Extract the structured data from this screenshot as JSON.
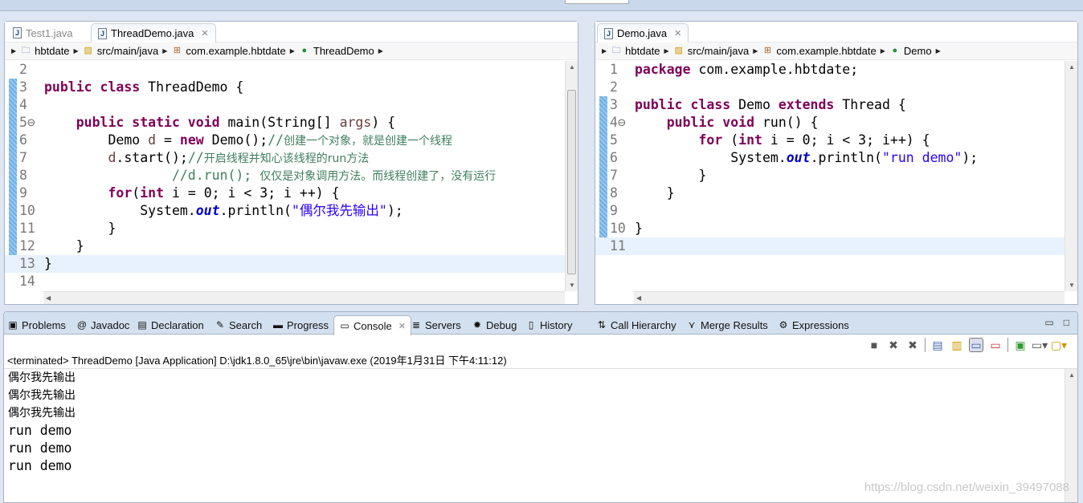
{
  "left_editor": {
    "tabs": [
      {
        "label": "Test1.java",
        "active": false
      },
      {
        "label": "ThreadDemo.java",
        "active": true
      }
    ],
    "breadcrumb": [
      "hbtdate",
      "src/main/java",
      "com.example.hbtdate",
      "ThreadDemo"
    ],
    "lines": [
      {
        "n": "2",
        "t": []
      },
      {
        "n": "3",
        "t": [
          [
            "public class ",
            "kw"
          ],
          [
            "ThreadDemo {",
            ""
          ]
        ]
      },
      {
        "n": "4",
        "t": []
      },
      {
        "n": "5⊖",
        "t": [
          [
            "    public static void ",
            "kw"
          ],
          [
            "main(String[] ",
            ""
          ],
          [
            "args",
            "var"
          ],
          [
            ") {",
            ""
          ]
        ]
      },
      {
        "n": "6",
        "t": [
          [
            "        Demo ",
            ""
          ],
          [
            "d",
            "var"
          ],
          [
            " = ",
            ""
          ],
          [
            "new ",
            "kw"
          ],
          [
            "Demo();",
            ""
          ],
          [
            "//",
            "cmm"
          ],
          [
            "创建一个对象，就是创建一个线程",
            "cm"
          ]
        ]
      },
      {
        "n": "7",
        "t": [
          [
            "        ",
            ""
          ],
          [
            "d",
            "var"
          ],
          [
            ".start();",
            ""
          ],
          [
            "//",
            "cmm"
          ],
          [
            "开启线程并知心该线程的run方法",
            "cm"
          ]
        ]
      },
      {
        "n": "8",
        "t": [
          [
            "                //d.run(); ",
            "cmm"
          ],
          [
            "仅仅是对象调用方法。而线程创建了，没有运行",
            "cm"
          ]
        ]
      },
      {
        "n": "9",
        "t": [
          [
            "        ",
            ""
          ],
          [
            "for",
            "kw"
          ],
          [
            "(",
            ""
          ],
          [
            "int ",
            "kw"
          ],
          [
            "i = 0; i < 3; i ++) {",
            ""
          ]
        ]
      },
      {
        "n": "10",
        "t": [
          [
            "            System.",
            ""
          ],
          [
            "out",
            "fld"
          ],
          [
            ".println(",
            ""
          ],
          [
            "\"偶尔我先输出\"",
            "st"
          ],
          [
            ");",
            ""
          ]
        ]
      },
      {
        "n": "11",
        "t": [
          [
            "        }",
            ""
          ]
        ]
      },
      {
        "n": "12",
        "t": [
          [
            "    }",
            ""
          ]
        ]
      },
      {
        "n": "13",
        "t": [
          [
            "}",
            ""
          ]
        ]
      },
      {
        "n": "14",
        "t": []
      }
    ]
  },
  "right_editor": {
    "tabs": [
      {
        "label": "Demo.java",
        "active": true
      }
    ],
    "breadcrumb": [
      "hbtdate",
      "src/main/java",
      "com.example.hbtdate",
      "Demo"
    ],
    "lines": [
      {
        "n": "1",
        "t": [
          [
            "package ",
            "kw"
          ],
          [
            "com.example.hbtdate;",
            ""
          ]
        ]
      },
      {
        "n": "2",
        "t": []
      },
      {
        "n": "3",
        "t": [
          [
            "public class ",
            "kw"
          ],
          [
            "Demo ",
            ""
          ],
          [
            "extends ",
            "kw"
          ],
          [
            "Thread {",
            ""
          ]
        ]
      },
      {
        "n": "4⊖",
        "t": [
          [
            "    public void ",
            "kw"
          ],
          [
            "run() {",
            ""
          ]
        ]
      },
      {
        "n": "5",
        "t": [
          [
            "        for ",
            "kw"
          ],
          [
            "(",
            ""
          ],
          [
            "int ",
            "kw"
          ],
          [
            "i = 0; i < 3; i++) {",
            ""
          ]
        ]
      },
      {
        "n": "6",
        "t": [
          [
            "            System.",
            ""
          ],
          [
            "out",
            "fld"
          ],
          [
            ".println(",
            ""
          ],
          [
            "\"run demo\"",
            "st"
          ],
          [
            ");",
            ""
          ]
        ]
      },
      {
        "n": "7",
        "t": [
          [
            "        }",
            ""
          ]
        ]
      },
      {
        "n": "8",
        "t": [
          [
            "    }",
            ""
          ]
        ]
      },
      {
        "n": "9",
        "t": []
      },
      {
        "n": "10",
        "t": [
          [
            "}",
            ""
          ]
        ]
      },
      {
        "n": "11",
        "t": []
      }
    ]
  },
  "panel": {
    "tabs": [
      {
        "label": "Problems",
        "icon": "problems-icon",
        "g": "▣"
      },
      {
        "label": "Javadoc",
        "icon": "javadoc-icon",
        "g": "@"
      },
      {
        "label": "Declaration",
        "icon": "declaration-icon",
        "g": "▤"
      },
      {
        "label": "Search",
        "icon": "search-icon",
        "g": "✎"
      },
      {
        "label": "Progress",
        "icon": "progress-icon",
        "g": "▬"
      },
      {
        "label": "Console",
        "icon": "console-icon",
        "g": "▭",
        "active": true
      },
      {
        "label": "Servers",
        "icon": "servers-icon",
        "g": "≣"
      },
      {
        "label": "Debug",
        "icon": "debug-icon",
        "g": "✹"
      },
      {
        "label": "History",
        "icon": "history-icon",
        "g": "▯"
      },
      {
        "label": "Call Hierarchy",
        "icon": "call-hierarchy-icon",
        "g": "⇅"
      },
      {
        "label": "Merge Results",
        "icon": "merge-results-icon",
        "g": "⋎"
      },
      {
        "label": "Expressions",
        "icon": "expressions-icon",
        "g": "⚙"
      }
    ],
    "terminated": "<terminated> ThreadDemo [Java Application] D:\\jdk1.8.0_65\\jre\\bin\\javaw.exe (2019年1月31日 下午4:11:12)",
    "output": [
      "偶尔我先输出",
      "偶尔我先输出",
      "偶尔我先输出",
      "run demo",
      "run demo",
      "run demo"
    ],
    "watermark": "https://blog.csdn.net/weixin_39497088"
  }
}
